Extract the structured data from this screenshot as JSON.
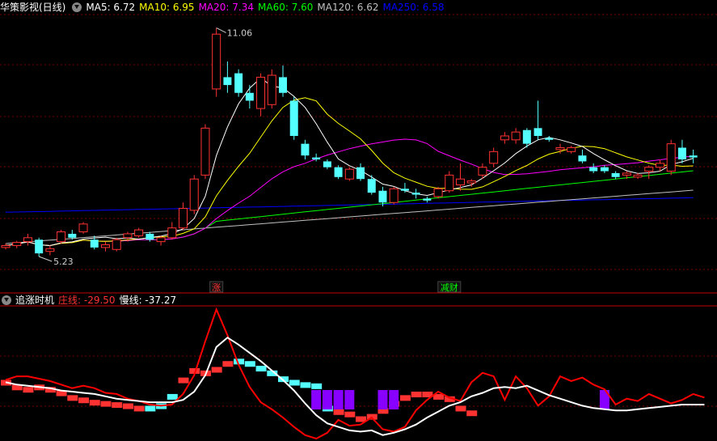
{
  "main_header": {
    "title": "华策影视(日线)",
    "ma5_label": "MA5: 6.72",
    "ma10_label": "MA10: 6.95",
    "ma20_label": "MA20: 7.34",
    "ma60_label": "MA60: 7.60",
    "ma120_label": "MA120: 6.62",
    "ma250_label": "MA250: 6.58"
  },
  "sub_header": {
    "title": "追涨时机",
    "fast_label": "庄线: -29.50",
    "slow_label": "慢线: -37.27"
  },
  "colors": {
    "up": "#ff3232",
    "down": "#54ffff",
    "ma5": "#ffffff",
    "ma10": "#ffff00",
    "ma20": "#ff00ff",
    "ma60": "#00ff00",
    "ma120": "#c0c0c0",
    "ma250": "#0000ff",
    "fast": "#ff0000",
    "slow": "#ffffff",
    "signal": "#8800ff",
    "grid": "#7a0000",
    "divider": "#c00000"
  },
  "chart_data": [
    {
      "type": "candlestick",
      "ylim": [
        4.6,
        11.4
      ],
      "annotations": {
        "high_label": "11.06",
        "low_label": "5.23"
      },
      "markers": [
        {
          "label": "涨",
          "index": 19,
          "color": "#ff3232"
        },
        {
          "label": "减财",
          "index": 40,
          "color": "#00ff00"
        }
      ],
      "candles": [
        [
          5.45,
          5.55,
          5.4,
          5.5
        ],
        [
          5.5,
          5.62,
          5.43,
          5.58
        ],
        [
          5.6,
          5.8,
          5.5,
          5.7
        ],
        [
          5.65,
          5.7,
          5.22,
          5.3
        ],
        [
          5.35,
          5.5,
          5.25,
          5.42
        ],
        [
          5.6,
          5.9,
          5.55,
          5.85
        ],
        [
          5.8,
          5.9,
          5.65,
          5.7
        ],
        [
          5.85,
          6.1,
          5.8,
          6.05
        ],
        [
          5.65,
          5.75,
          5.4,
          5.45
        ],
        [
          5.45,
          5.6,
          5.35,
          5.52
        ],
        [
          5.4,
          5.7,
          5.35,
          5.65
        ],
        [
          5.7,
          5.85,
          5.6,
          5.8
        ],
        [
          5.75,
          5.95,
          5.7,
          5.9
        ],
        [
          5.8,
          5.85,
          5.6,
          5.65
        ],
        [
          5.6,
          5.75,
          5.5,
          5.7
        ],
        [
          5.7,
          6.1,
          5.65,
          5.95
        ],
        [
          5.95,
          6.6,
          5.9,
          6.45
        ],
        [
          6.4,
          7.3,
          6.3,
          7.2
        ],
        [
          7.3,
          8.6,
          7.2,
          8.5
        ],
        [
          9.5,
          11.06,
          9.3,
          10.9
        ],
        [
          9.8,
          10.2,
          9.4,
          9.6
        ],
        [
          9.9,
          10.0,
          9.3,
          9.4
        ],
        [
          9.4,
          9.6,
          9.0,
          9.2
        ],
        [
          9.0,
          9.9,
          8.8,
          9.8
        ],
        [
          9.1,
          10.0,
          9.0,
          9.85
        ],
        [
          9.8,
          10.1,
          9.3,
          9.4
        ],
        [
          9.2,
          9.3,
          8.2,
          8.3
        ],
        [
          8.1,
          8.2,
          7.7,
          7.8
        ],
        [
          7.75,
          7.85,
          7.65,
          7.7
        ],
        [
          7.65,
          7.7,
          7.45,
          7.5
        ],
        [
          7.5,
          7.55,
          7.2,
          7.25
        ],
        [
          7.2,
          7.5,
          7.15,
          7.45
        ],
        [
          7.5,
          7.6,
          7.15,
          7.2
        ],
        [
          7.2,
          7.3,
          6.8,
          6.85
        ],
        [
          6.9,
          7.0,
          6.5,
          6.6
        ],
        [
          6.6,
          7.0,
          6.55,
          6.95
        ],
        [
          6.95,
          7.1,
          6.85,
          6.9
        ],
        [
          6.85,
          6.95,
          6.7,
          6.8
        ],
        [
          6.7,
          6.75,
          6.6,
          6.65
        ],
        [
          6.75,
          7.0,
          6.7,
          6.95
        ],
        [
          6.9,
          7.4,
          6.85,
          7.3
        ],
        [
          7.05,
          7.6,
          6.9,
          7.2
        ],
        [
          7.1,
          7.2,
          7.0,
          7.15
        ],
        [
          7.3,
          7.6,
          7.2,
          7.5
        ],
        [
          7.6,
          8.0,
          7.5,
          7.9
        ],
        [
          8.2,
          8.4,
          8.1,
          8.3
        ],
        [
          8.2,
          8.5,
          8.1,
          8.4
        ],
        [
          8.45,
          8.5,
          8.0,
          8.1
        ],
        [
          8.5,
          9.2,
          8.2,
          8.3
        ],
        [
          8.25,
          8.3,
          8.15,
          8.2
        ],
        [
          7.95,
          8.1,
          7.85,
          8.0
        ],
        [
          7.9,
          8.05,
          7.85,
          8.0
        ],
        [
          7.8,
          7.95,
          7.6,
          7.65
        ],
        [
          7.5,
          7.6,
          7.35,
          7.4
        ],
        [
          7.5,
          7.55,
          7.35,
          7.4
        ],
        [
          7.35,
          7.4,
          7.2,
          7.25
        ],
        [
          7.3,
          7.4,
          7.2,
          7.35
        ],
        [
          7.25,
          7.35,
          7.2,
          7.3
        ],
        [
          7.4,
          7.55,
          7.2,
          7.5
        ],
        [
          7.5,
          7.7,
          7.4,
          7.6
        ],
        [
          7.4,
          8.2,
          7.3,
          8.1
        ],
        [
          8.0,
          8.2,
          7.6,
          7.7
        ],
        [
          7.8,
          7.95,
          7.6,
          7.75
        ]
      ]
    },
    {
      "type": "line",
      "ylim": [
        -60,
        55
      ],
      "series": [
        {
          "name": "庄线",
          "values": [
            -8,
            -5,
            -5,
            -7,
            -9,
            -12,
            -15,
            -13,
            -15,
            -19,
            -20,
            -24,
            -26,
            -29,
            -30,
            -29,
            -20,
            -4,
            25,
            52,
            30,
            5,
            -14,
            -27,
            -33,
            -40,
            -48,
            -55,
            -58,
            -53,
            -42,
            -47,
            -46,
            -40,
            -50,
            -52,
            -48,
            -34,
            -25,
            -18,
            -23,
            -26,
            -10,
            -2,
            -5,
            -25,
            -5,
            -15,
            -30,
            -22,
            -5,
            -9,
            -6,
            -12,
            -16,
            -29,
            -24,
            -26,
            -20,
            -24,
            -28,
            -25,
            -20,
            -23
          ]
        },
        {
          "name": "慢线",
          "values": [
            -10,
            -12,
            -13,
            -14,
            -15,
            -17,
            -18,
            -19,
            -20,
            -22,
            -24,
            -25,
            -26,
            -27,
            -27,
            -27,
            -25,
            -18,
            -4,
            20,
            28,
            22,
            15,
            8,
            0,
            -8,
            -17,
            -28,
            -38,
            -45,
            -48,
            -51,
            -52,
            -51,
            -55,
            -53,
            -50,
            -46,
            -40,
            -35,
            -30,
            -27,
            -22,
            -19,
            -15,
            -14,
            -15,
            -13,
            -17,
            -21,
            -24,
            -27,
            -30,
            -32,
            -33,
            -34,
            -34,
            -33,
            -32,
            -31,
            -30,
            -29,
            -29,
            -29
          ]
        }
      ],
      "fill_bars": [
        -8,
        -12,
        -14,
        -12,
        -14,
        -17,
        -21,
        -23,
        -25,
        -26,
        -27,
        -28,
        -30,
        -30,
        -28,
        -20,
        -6,
        2,
        0,
        3,
        8,
        10,
        8,
        4,
        0,
        -5,
        -8,
        -10,
        -11,
        -30,
        -33,
        -35,
        -39,
        -37,
        -32,
        -26,
        -21,
        -18,
        -18,
        -20,
        -22,
        -30,
        -34
      ],
      "signal_indices": [
        28,
        29,
        30,
        31,
        34,
        35,
        54
      ]
    }
  ]
}
